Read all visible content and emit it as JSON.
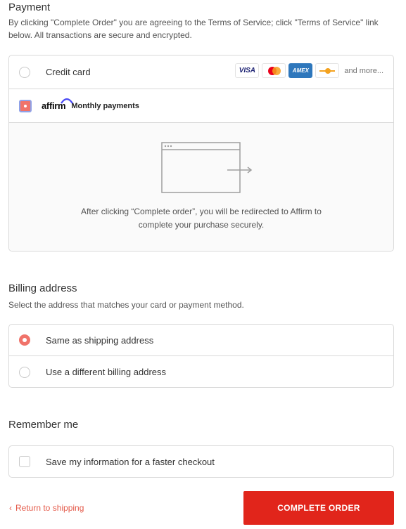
{
  "payment": {
    "title": "Payment",
    "subtitle": "By clicking \"Complete Order\" you are agreeing to the Terms of Service; click \"Terms of Service\" link below. All transactions are secure and encrypted.",
    "credit_card": {
      "label": "Credit card",
      "selected": false,
      "card_icons": [
        {
          "name": "visa-icon",
          "text": "VISA"
        },
        {
          "name": "mastercard-icon",
          "text": ""
        },
        {
          "name": "amex-icon",
          "text": "AMEX"
        },
        {
          "name": "discover-icon",
          "text": ""
        }
      ],
      "more_label": "and more..."
    },
    "affirm": {
      "logo": "affirm",
      "label": "Monthly payments",
      "selected": true,
      "redirect_message": "After clicking “Complete order”, you will be redirected to Affirm to complete your purchase securely."
    }
  },
  "billing": {
    "title": "Billing address",
    "subtitle": "Select the address that matches your card or payment method.",
    "options": [
      {
        "label": "Same as shipping address",
        "selected": true
      },
      {
        "label": "Use a different billing address",
        "selected": false
      }
    ]
  },
  "remember": {
    "title": "Remember me",
    "checkbox_label": "Save my information for a faster checkout",
    "checked": false
  },
  "footer": {
    "return_label": "Return to shipping",
    "complete_label": "COMPLETE ORDER"
  },
  "colors": {
    "accent": "#e1251b",
    "radio_selected": "#f0736a",
    "link": "#e45a4a"
  }
}
